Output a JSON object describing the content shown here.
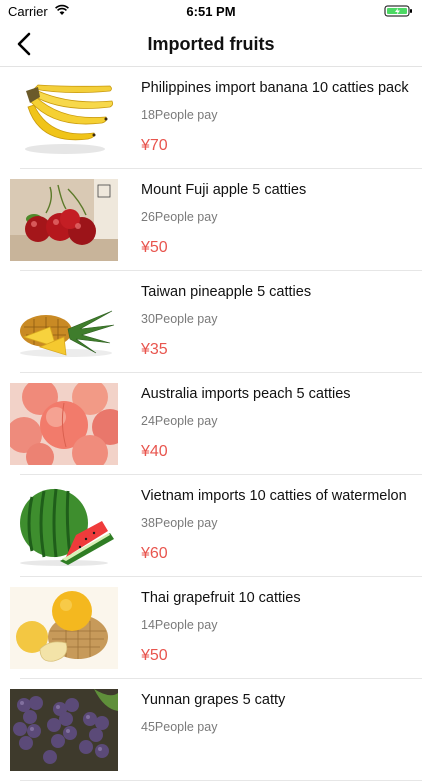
{
  "status_bar": {
    "carrier": "Carrier",
    "time": "6:51 PM",
    "battery_color": "#4cd964"
  },
  "nav": {
    "title": "Imported fruits",
    "back_icon": "chevron-left-icon"
  },
  "colors": {
    "price": "#e8554e",
    "count": "#7a7a7a",
    "separator": "#e6e6e6"
  },
  "products": [
    {
      "name": "Philippines import banana 10 catties pack",
      "count": "18People pay",
      "price": "¥70",
      "image": "banana-image"
    },
    {
      "name": "Mount Fuji apple 5 catties",
      "count": "26People pay",
      "price": "¥50",
      "image": "cherry-image"
    },
    {
      "name": "Taiwan pineapple 5 catties",
      "count": "30People pay",
      "price": "¥35",
      "image": "pineapple-image"
    },
    {
      "name": "Australia imports peach 5 catties",
      "count": "24People pay",
      "price": "¥40",
      "image": "peach-image"
    },
    {
      "name": "Vietnam imports 10 catties of watermelon",
      "count": "38People pay",
      "price": "¥60",
      "image": "watermelon-image"
    },
    {
      "name": "Thai grapefruit 10 catties",
      "count": "14People pay",
      "price": "¥50",
      "image": "grapefruit-image"
    },
    {
      "name": "Yunnan grapes 5 catty",
      "count": "45People pay",
      "price": "",
      "image": "grape-image"
    }
  ]
}
